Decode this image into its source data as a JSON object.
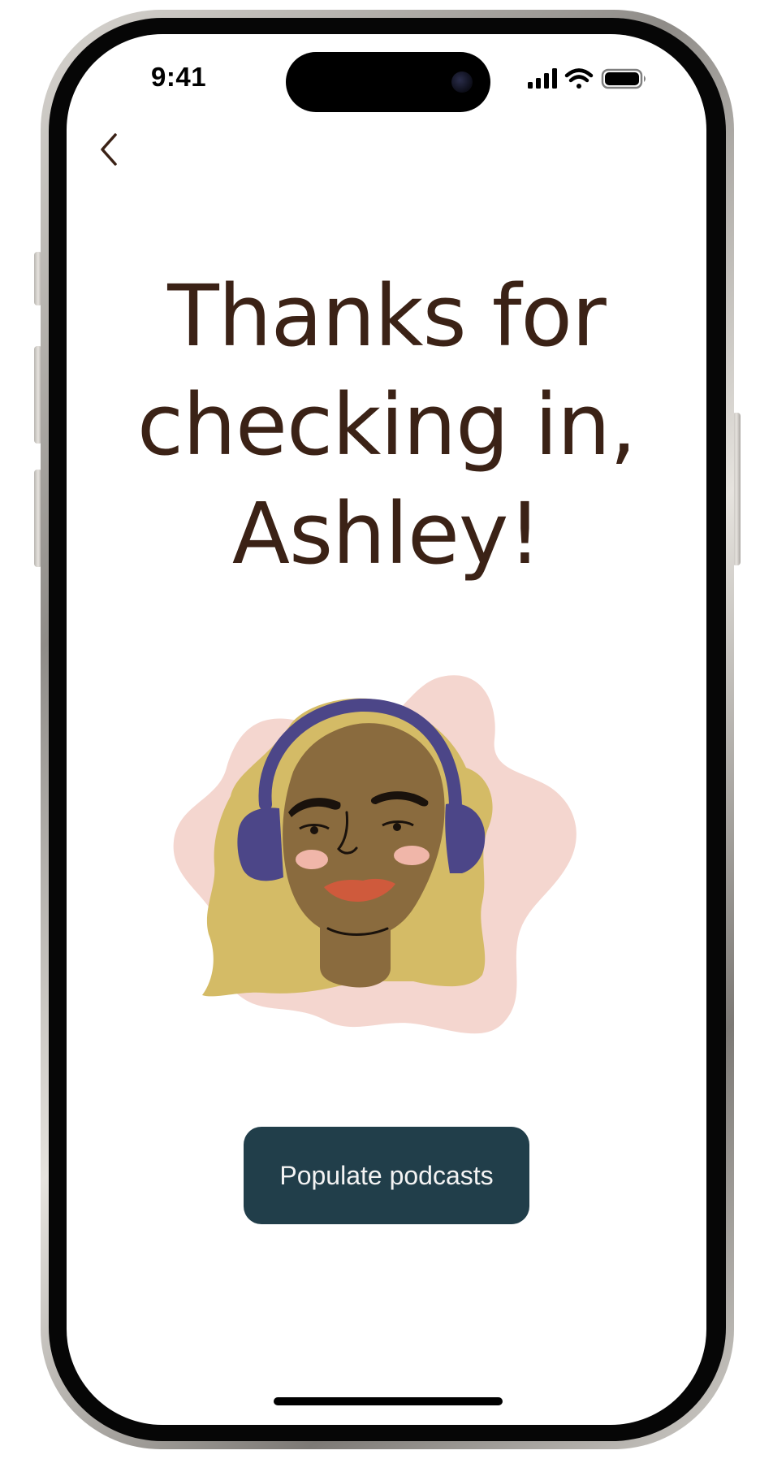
{
  "status_bar": {
    "time": "9:41",
    "icons": [
      "cellular-signal-icon",
      "wifi-icon",
      "battery-icon"
    ]
  },
  "nav": {
    "back_icon": "chevron-left-icon"
  },
  "headline": {
    "line1": "Thanks for",
    "line2": "checking in,",
    "line3": "Ashley!"
  },
  "illustration": {
    "icon": "avatar-with-headphones-illustration",
    "colors": {
      "background_blob": "#f4d6cf",
      "hair": "#d4bb66",
      "skin": "#8a6b3e",
      "headphones": "#4c4688",
      "cheeks": "#f0b6a9",
      "lips": "#cf5a3c"
    }
  },
  "cta": {
    "label": "Populate podcasts"
  },
  "colors": {
    "headline_text": "#3b2216",
    "button_bg": "#213e4a",
    "button_text": "#f3f3f3"
  }
}
